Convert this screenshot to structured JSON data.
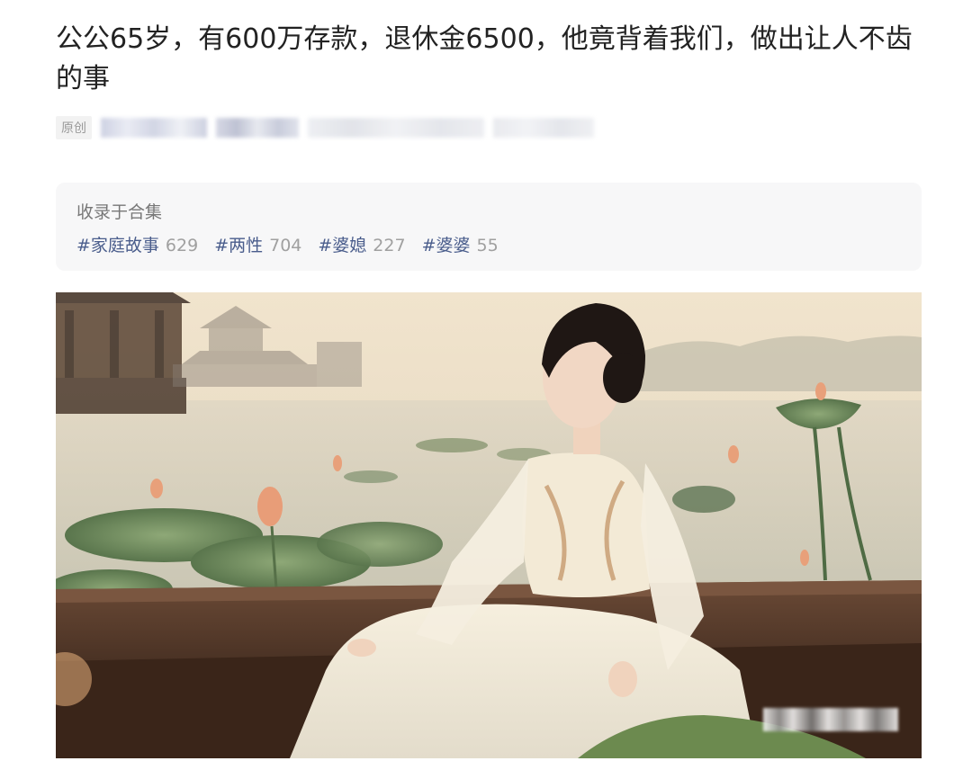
{
  "article": {
    "title": "公公65岁，有600万存款，退休金6500，他竟背着我们，做出让人不齿的事",
    "original_tag": "原创"
  },
  "collection": {
    "heading": "收录于合集",
    "tags": [
      {
        "name": "#家庭故事",
        "count": "629"
      },
      {
        "name": "#两性",
        "count": "704"
      },
      {
        "name": "#婆媳",
        "count": "227"
      },
      {
        "name": "#婆婆",
        "count": "55"
      }
    ]
  },
  "hero_image": {
    "subject": "woman-in-white-dress-on-boat-with-lotus"
  },
  "colors": {
    "title_text": "#222222",
    "tag_link": "#4a5d8c",
    "tag_count": "#a0a0a0",
    "collection_bg": "#f7f7f8"
  }
}
